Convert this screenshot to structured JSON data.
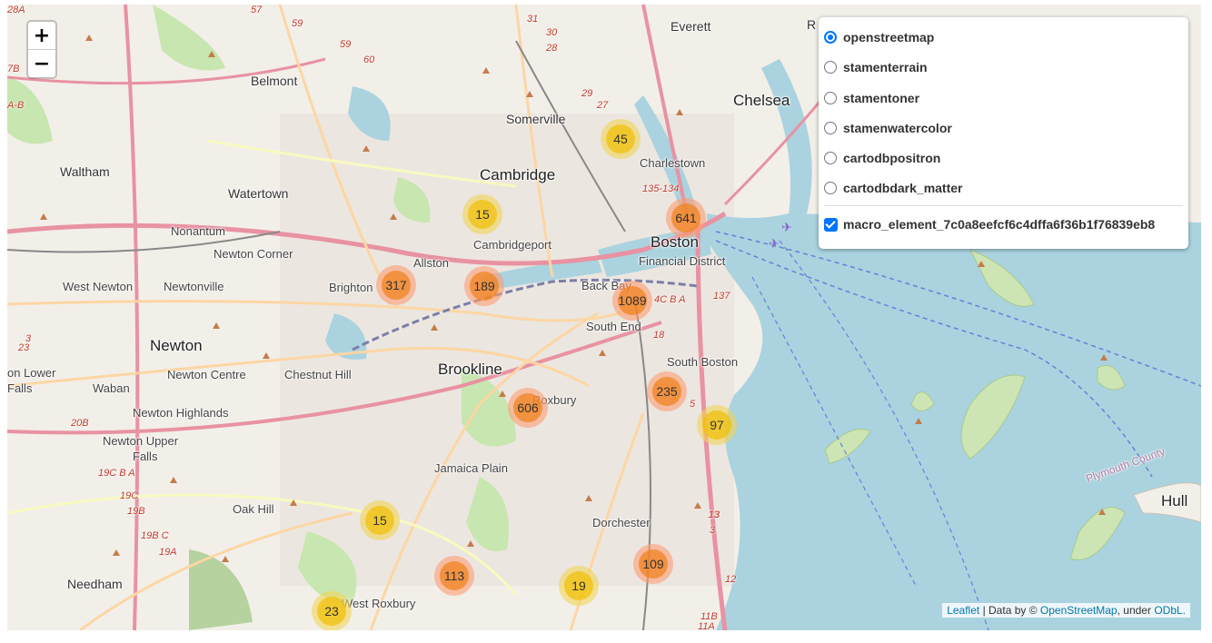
{
  "places": [
    {
      "label": "Everett",
      "cls": "mid"
    },
    {
      "label": "Belmont",
      "cls": "mid"
    },
    {
      "label": "Somerville",
      "cls": "mid"
    },
    {
      "label": "Chelsea",
      "cls": "big"
    },
    {
      "label": "Waltham",
      "cls": "mid"
    },
    {
      "label": "Cambridge",
      "cls": "big"
    },
    {
      "label": "Charlestown",
      "cls": "sm"
    },
    {
      "label": "Watertown",
      "cls": "mid"
    },
    {
      "label": "Nonantum",
      "cls": "sm"
    },
    {
      "label": "Boston",
      "cls": "big"
    },
    {
      "label": "Cambridgeport",
      "cls": "sm"
    },
    {
      "label": "Newton Corner",
      "cls": "sm"
    },
    {
      "label": "Allston",
      "cls": "sm"
    },
    {
      "label": "Financial District",
      "cls": "sm"
    },
    {
      "label": "West Newton",
      "cls": "sm"
    },
    {
      "label": "Newtonville",
      "cls": "sm"
    },
    {
      "label": "Brighton",
      "cls": "sm"
    },
    {
      "label": "Back Bay",
      "cls": "sm"
    },
    {
      "label": "South End",
      "cls": "sm"
    },
    {
      "label": "Newton",
      "cls": "big"
    },
    {
      "label": "South Boston",
      "cls": "sm"
    },
    {
      "label": "Brookline",
      "cls": "big"
    },
    {
      "label": "Newton Centre",
      "cls": "sm"
    },
    {
      "label": "Chestnut Hill",
      "cls": "sm"
    },
    {
      "label": "Waban",
      "cls": "sm"
    },
    {
      "label": "Roxbury",
      "cls": "sm"
    },
    {
      "label": "Newton Highlands",
      "cls": "sm"
    },
    {
      "label": "Newton Upper",
      "cls": "sm"
    },
    {
      "label": "Falls",
      "cls": "sm"
    },
    {
      "label": "Jamaica Plain",
      "cls": "sm"
    },
    {
      "label": "Oak Hill",
      "cls": "sm"
    },
    {
      "label": "Dorchester",
      "cls": "sm"
    },
    {
      "label": "Hull",
      "cls": "big"
    },
    {
      "label": "Needham",
      "cls": "mid"
    },
    {
      "label": "West Roxbury",
      "cls": "sm"
    },
    {
      "label": "R",
      "cls": "mid"
    },
    {
      "label": "on Lower",
      "cls": "sm"
    },
    {
      "label": "Falls",
      "cls": "sm"
    },
    {
      "label": "Plymouth County",
      "cls": "sm"
    }
  ],
  "shields": [
    "28A",
    "57",
    "59",
    "59",
    "60",
    "31",
    "30",
    "28",
    "29",
    "27",
    "135-134",
    "137",
    "4C B A",
    "18",
    "5",
    "13",
    "3",
    "20B",
    "19C B A",
    "19C",
    "19B",
    "19B C",
    "19A",
    "23",
    "3",
    "13",
    "12",
    "11B",
    "11A",
    "7B",
    "A-B"
  ],
  "clusters": [
    {
      "count": "45",
      "size": "small"
    },
    {
      "count": "641",
      "size": "large"
    },
    {
      "count": "15",
      "size": "small"
    },
    {
      "count": "317",
      "size": "large"
    },
    {
      "count": "189",
      "size": "large"
    },
    {
      "count": "1089",
      "size": "large"
    },
    {
      "count": "606",
      "size": "large"
    },
    {
      "count": "235",
      "size": "large"
    },
    {
      "count": "97",
      "size": "small"
    },
    {
      "count": "15",
      "size": "small"
    },
    {
      "count": "113",
      "size": "large"
    },
    {
      "count": "19",
      "size": "small"
    },
    {
      "count": "109",
      "size": "large"
    },
    {
      "count": "23",
      "size": "small"
    }
  ],
  "zoom": {
    "in": "+",
    "out": "−"
  },
  "layers": {
    "base": [
      {
        "label": "openstreetmap",
        "selected": true
      },
      {
        "label": "stamenterrain",
        "selected": false
      },
      {
        "label": "stamentoner",
        "selected": false
      },
      {
        "label": "stamenwatercolor",
        "selected": false
      },
      {
        "label": "cartodbpositron",
        "selected": false
      },
      {
        "label": "cartodbdark_matter",
        "selected": false
      }
    ],
    "overlay": {
      "label": "macro_element_7c0a8eefcf6c4dffa6f36b1f76839eb8",
      "checked": true
    }
  },
  "attribution": {
    "leaflet": "Leaflet",
    "sep": " | Data by © ",
    "osm": "OpenStreetMap",
    "under": ", under ",
    "odbl": "ODbL."
  },
  "colors": {
    "water": "#aad3df",
    "park": "#c8e6b0",
    "motorway": "#e892a2",
    "primary": "#fcd6a4",
    "rail": "#7b7fa8",
    "accent": "#0075ff"
  }
}
